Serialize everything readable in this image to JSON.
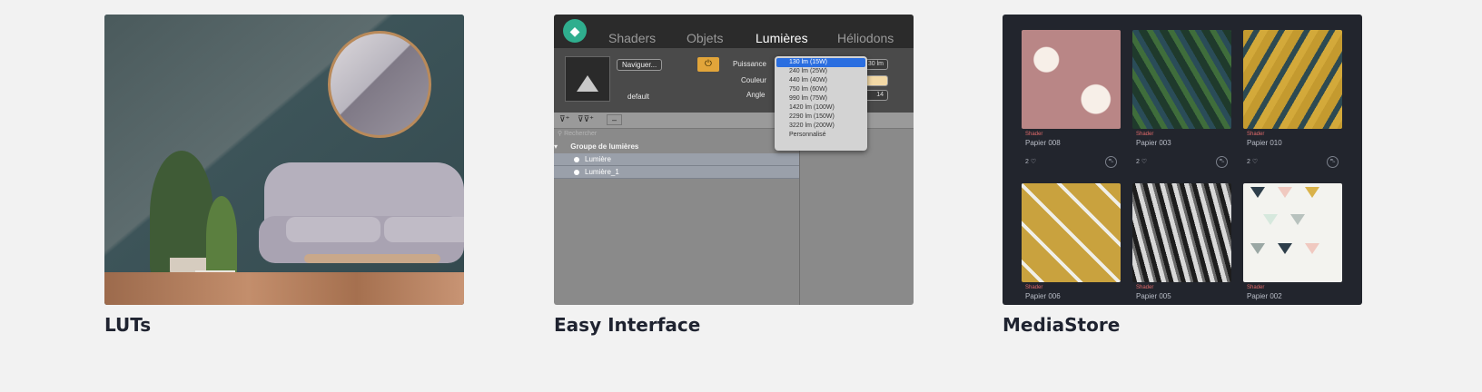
{
  "cards": [
    {
      "title": "LUTs"
    },
    {
      "title": "Easy Interface",
      "app": {
        "tabs": [
          "Shaders",
          "Objets",
          "Lumières",
          "Héliodons"
        ],
        "active_tab": "Lumières",
        "navigate_button": "Naviguer...",
        "preview_label": "default",
        "power_label": "Puissance",
        "color_label": "Couleur",
        "angle_label": "Angle",
        "power_value": "30 lm",
        "angle_value": "14",
        "search_placeholder": "Rechercher",
        "group_label": "Groupe de lumières",
        "items": [
          "Lumière",
          "Lumière_1"
        ],
        "dropdown_options": [
          "130 lm (15W)",
          "240 lm (25W)",
          "440 lm (40W)",
          "750 lm (60W)",
          "990 lm (75W)",
          "1420 lm (100W)",
          "2290 lm (150W)",
          "3220 lm (200W)",
          "Personnalisé"
        ],
        "dropdown_selected": "130 lm (15W)",
        "accent_color": "#e2a53a"
      }
    },
    {
      "title": "MediaStore",
      "tiles": [
        {
          "type": "Shader",
          "name": "Papier 008",
          "likes": "2"
        },
        {
          "type": "Shader",
          "name": "Papier 003",
          "likes": "2"
        },
        {
          "type": "Shader",
          "name": "Papier 010",
          "likes": "2"
        },
        {
          "type": "Shader",
          "name": "Papier 006"
        },
        {
          "type": "Shader",
          "name": "Papier 005"
        },
        {
          "type": "Shader",
          "name": "Papier 002"
        }
      ]
    }
  ]
}
